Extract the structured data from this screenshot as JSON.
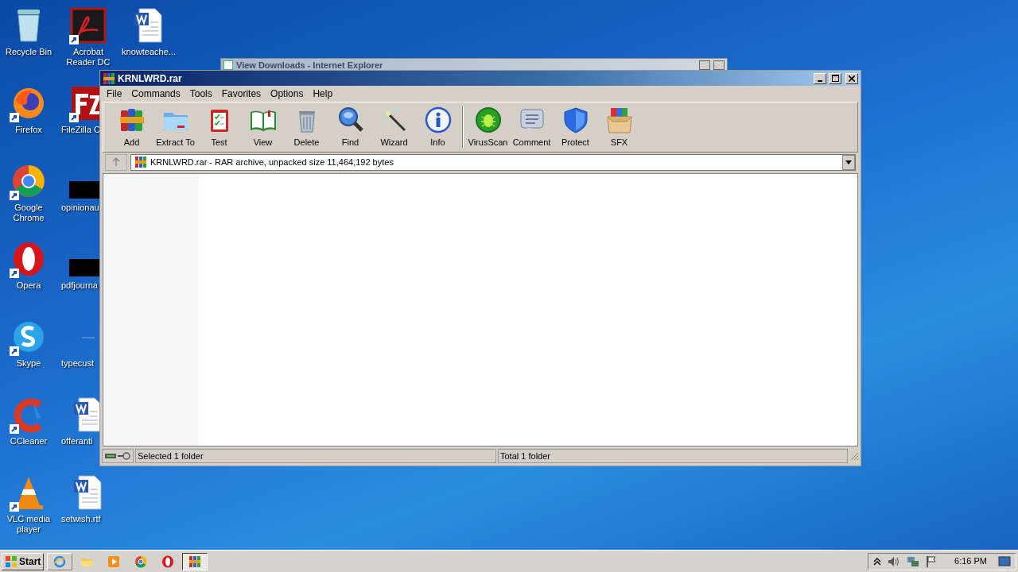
{
  "desktop": {
    "icons": [
      {
        "label": "Recycle Bin"
      },
      {
        "label": "Firefox"
      },
      {
        "label": "Google Chrome"
      },
      {
        "label": "Opera"
      },
      {
        "label": "Skype"
      },
      {
        "label": "CCleaner"
      },
      {
        "label": "VLC media player"
      },
      {
        "label": "Acrobat Reader DC"
      },
      {
        "label": "FileZilla C"
      },
      {
        "label": "opinionau"
      },
      {
        "label": "pdfjourna"
      },
      {
        "label": "typecust"
      },
      {
        "label": "offeranti"
      },
      {
        "label": "setwish.rtf"
      },
      {
        "label": "knowteache..."
      }
    ]
  },
  "background_window": {
    "title": "View Downloads - Internet Explorer"
  },
  "window": {
    "title": "KRNLWRD.rar",
    "menu": [
      "File",
      "Commands",
      "Tools",
      "Favorites",
      "Options",
      "Help"
    ],
    "toolbar": [
      {
        "label": "Add"
      },
      {
        "label": "Extract To"
      },
      {
        "label": "Test"
      },
      {
        "label": "View"
      },
      {
        "label": "Delete"
      },
      {
        "label": "Find"
      },
      {
        "label": "Wizard"
      },
      {
        "label": "Info"
      },
      {
        "label": "VirusScan"
      },
      {
        "label": "Comment"
      },
      {
        "label": "Protect"
      },
      {
        "label": "SFX"
      }
    ],
    "address": "KRNLWRD.rar - RAR archive, unpacked size 11,464,192 bytes",
    "status_bar": {
      "left": "Selected 1 folder",
      "right": "Total 1 folder"
    }
  },
  "taskbar": {
    "start": "Start",
    "apps": [
      {
        "selected": false
      },
      {
        "selected": false
      },
      {
        "selected": false
      },
      {
        "selected": false
      },
      {
        "selected": false
      },
      {
        "selected": true
      }
    ],
    "clock": "6:16 PM"
  }
}
